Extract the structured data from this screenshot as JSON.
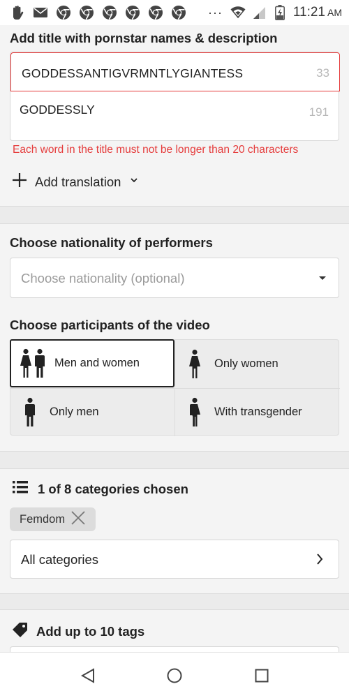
{
  "status_bar": {
    "time": "11:21",
    "ampm": "AM",
    "dots": "···",
    "left_icons": [
      "hand-icon",
      "mail-icon",
      "chrome-icon",
      "chrome-icon",
      "chrome-icon",
      "chrome-icon",
      "chrome-icon",
      "chrome-icon"
    ],
    "right_icons": [
      "wifi-icon",
      "signal-icon",
      "battery-charging-icon"
    ]
  },
  "title_section": {
    "label": "Add title with pornstar names & description",
    "title_value": "GODDESSANTIGVRMNTLYGIANTESS",
    "title_counter": "33",
    "description_value": "GODDESSLY",
    "description_counter": "191",
    "error": "Each word in the title must not be longer than 20 characters",
    "add_translation": "Add translation"
  },
  "nationality": {
    "label": "Choose nationality of performers",
    "placeholder": "Choose nationality (optional)"
  },
  "participants": {
    "label": "Choose participants of the video",
    "options": [
      {
        "label": "Men and women",
        "icon": "man-woman-icon",
        "selected": true
      },
      {
        "label": "Only women",
        "icon": "woman-icon",
        "selected": false
      },
      {
        "label": "Only men",
        "icon": "man-icon",
        "selected": false
      },
      {
        "label": "With transgender",
        "icon": "transgender-icon",
        "selected": false
      }
    ]
  },
  "categories": {
    "heading": "1 of 8 categories chosen",
    "chips": [
      "Femdom"
    ],
    "all_label": "All categories"
  },
  "tags": {
    "heading": "Add up to 10 tags"
  },
  "nav": {
    "buttons": [
      "back-icon",
      "home-icon",
      "recents-icon"
    ]
  },
  "colors": {
    "error": "#e53b3b",
    "border": "#d6d6d6",
    "background": "#f4f4f4"
  }
}
